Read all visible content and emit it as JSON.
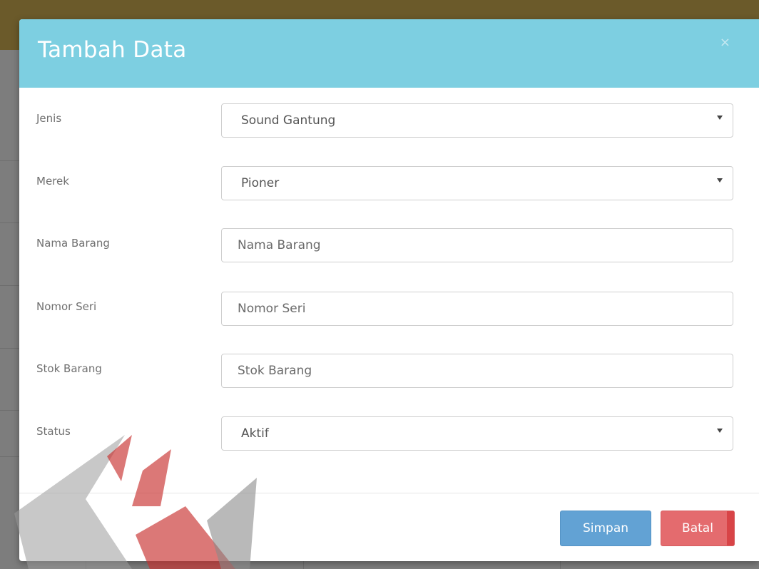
{
  "modal": {
    "title": "Tambah Data",
    "close_symbol": "×"
  },
  "form": {
    "jenis": {
      "label": "Jenis",
      "value": "Sound Gantung"
    },
    "merek": {
      "label": "Merek",
      "value": "Pioner"
    },
    "nama_barang": {
      "label": "Nama Barang",
      "placeholder": "Nama Barang"
    },
    "nomor_seri": {
      "label": "Nomor Seri",
      "placeholder": "Nomor Seri"
    },
    "stok_barang": {
      "label": "Stok Barang",
      "placeholder": "Stok Barang"
    },
    "status": {
      "label": "Status",
      "value": "Aktif"
    }
  },
  "buttons": {
    "save_label": "Simpan",
    "cancel_label": "Batal"
  },
  "colors": {
    "header": "#7dcfe1",
    "save": "#62a2d4",
    "cancel": "#e46b6e"
  },
  "icons": {
    "close": "close-icon",
    "caret": "chevron-down-icon"
  }
}
